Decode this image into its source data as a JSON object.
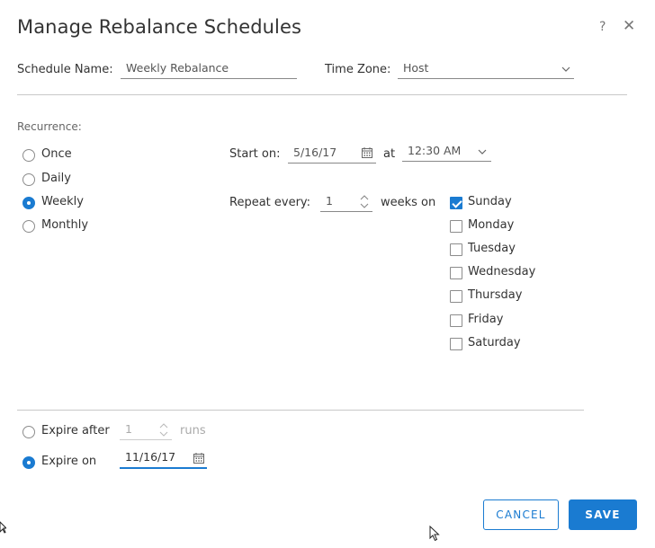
{
  "dialog": {
    "title": "Manage Rebalance Schedules",
    "help": "?",
    "close": "✕"
  },
  "schedule": {
    "name_label": "Schedule Name:",
    "name_value": "Weekly Rebalance",
    "timezone_label": "Time Zone:",
    "timezone_value": "Host"
  },
  "recurrence": {
    "label": "Recurrence:",
    "options": [
      {
        "label": "Once",
        "selected": false
      },
      {
        "label": "Daily",
        "selected": false
      },
      {
        "label": "Weekly",
        "selected": true
      },
      {
        "label": "Monthly",
        "selected": false
      }
    ],
    "start_label": "Start on:",
    "start_date": "5/16/17",
    "at_label": "at",
    "start_time": "12:30 AM",
    "repeat_label": "Repeat every:",
    "repeat_value": "1",
    "weeks_on_label": "weeks on",
    "days": [
      {
        "label": "Sunday",
        "checked": true
      },
      {
        "label": "Monday",
        "checked": false
      },
      {
        "label": "Tuesday",
        "checked": false
      },
      {
        "label": "Wednesday",
        "checked": false
      },
      {
        "label": "Thursday",
        "checked": false
      },
      {
        "label": "Friday",
        "checked": false
      },
      {
        "label": "Saturday",
        "checked": false
      }
    ]
  },
  "expire": {
    "after_label": "Expire after",
    "after_value": "1",
    "runs_label": "runs",
    "on_label": "Expire on",
    "on_date": "11/16/17",
    "selected": "on"
  },
  "buttons": {
    "cancel": "CANCEL",
    "save": "SAVE"
  },
  "colors": {
    "accent": "#1a7bd1",
    "text": "#333333",
    "muted": "#aaaaaa"
  }
}
